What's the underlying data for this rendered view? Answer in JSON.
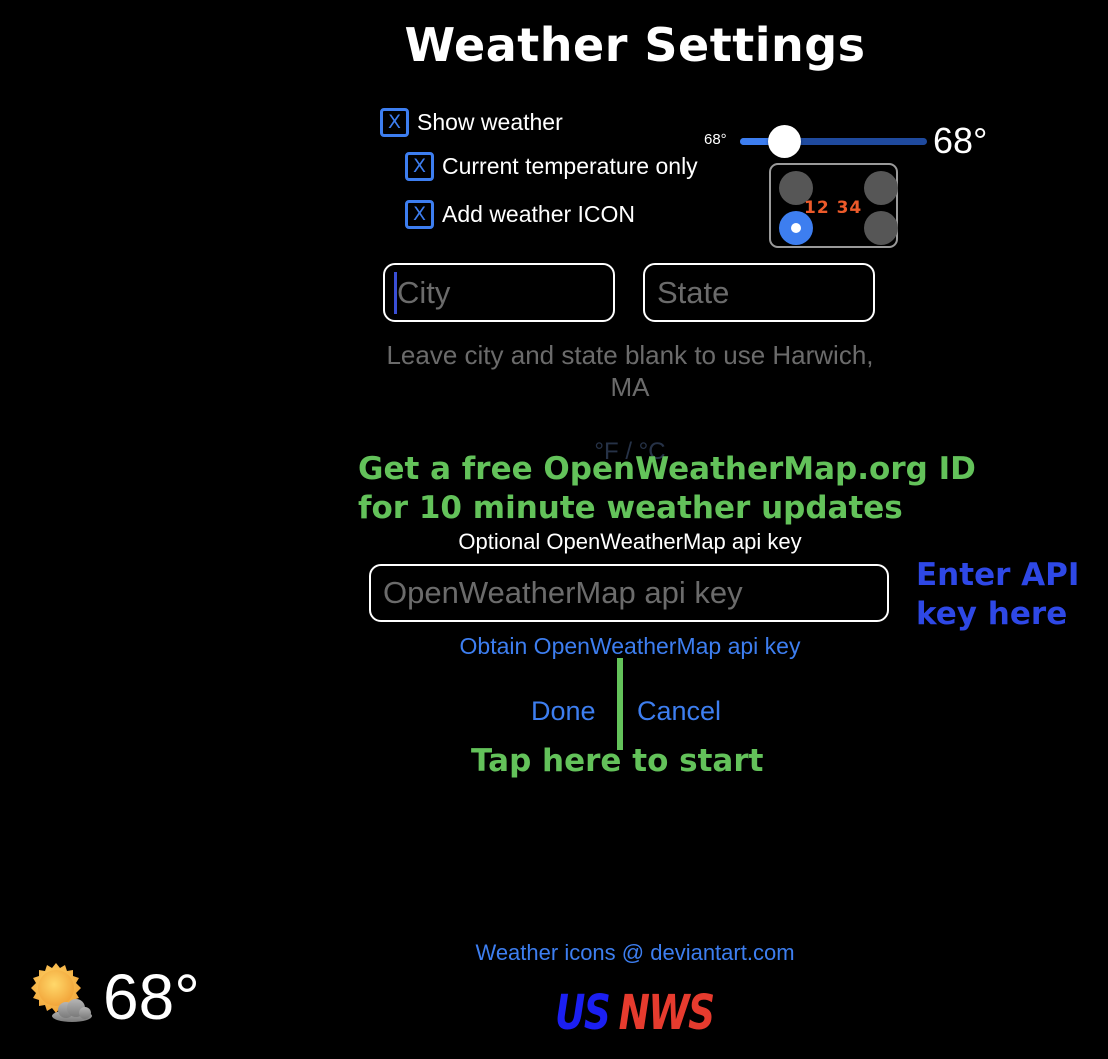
{
  "header": {
    "title": "Weather Settings"
  },
  "options": {
    "show_weather": {
      "label": "Show weather",
      "checked": true,
      "mark": "X"
    },
    "current_temp_only": {
      "label": "Current temperature only",
      "checked": true,
      "mark": "X"
    },
    "add_icon": {
      "label": "Add weather ICON",
      "checked": true,
      "mark": "X"
    }
  },
  "size_slider": {
    "min_label": "68°",
    "value_label": "68°",
    "fraction": 0.24
  },
  "position_picker": {
    "sample_text": "12 34",
    "positions": [
      "top-left",
      "top-right",
      "bottom-left",
      "bottom-right"
    ],
    "selected": "bottom-left",
    "sample_color": "#ec5a2a"
  },
  "location": {
    "city_placeholder": "City",
    "city_value": "",
    "state_placeholder": "State",
    "state_value": "",
    "hint": "Leave city and state blank to use Harwich, MA"
  },
  "units": {
    "label": "°F / °C"
  },
  "annotations": {
    "free_id": "Get a free OpenWeatherMap.org ID\nfor 10 minute weather updates",
    "enter_api": "Enter API\nkey here",
    "tap_start": "Tap here to start"
  },
  "api": {
    "label": "Optional OpenWeatherMap api key",
    "placeholder": "OpenWeatherMap api key",
    "value": "",
    "obtain_link": "Obtain OpenWeatherMap api key"
  },
  "actions": {
    "done": "Done",
    "cancel": "Cancel"
  },
  "footer": {
    "credit": "Weather icons @  deviantart.com",
    "logo_us": "US",
    "logo_nws": "NWS"
  },
  "preview": {
    "icon": "partly-sunny-icon",
    "temperature": "68°"
  },
  "colors": {
    "accent": "#3d7ef0",
    "annotation_green": "#63c25a",
    "annotation_blue": "#2e48e6",
    "placeholder": "#6b6b6b"
  }
}
